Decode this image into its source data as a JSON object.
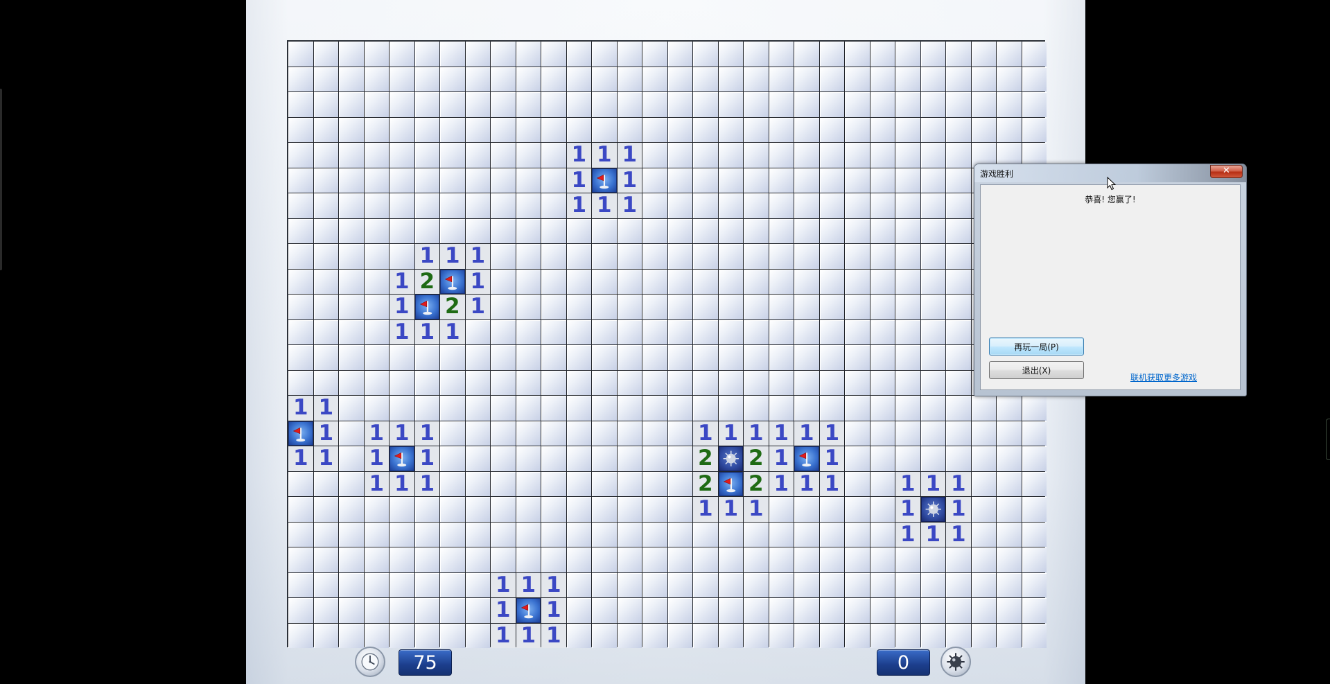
{
  "game": {
    "columns": 30,
    "rows": 24,
    "time": "75",
    "mines_remaining": "0",
    "revealed": [
      {
        "r": 4,
        "c": 11,
        "v": "1"
      },
      {
        "r": 4,
        "c": 12,
        "v": "1"
      },
      {
        "r": 4,
        "c": 13,
        "v": "1"
      },
      {
        "r": 5,
        "c": 11,
        "v": "1"
      },
      {
        "r": 5,
        "c": 12,
        "v": "flag"
      },
      {
        "r": 5,
        "c": 13,
        "v": "1"
      },
      {
        "r": 6,
        "c": 11,
        "v": "1"
      },
      {
        "r": 6,
        "c": 12,
        "v": "1"
      },
      {
        "r": 6,
        "c": 13,
        "v": "1"
      },
      {
        "r": 8,
        "c": 5,
        "v": "1"
      },
      {
        "r": 8,
        "c": 6,
        "v": "1"
      },
      {
        "r": 8,
        "c": 7,
        "v": "1"
      },
      {
        "r": 9,
        "c": 4,
        "v": "1"
      },
      {
        "r": 9,
        "c": 5,
        "v": "2"
      },
      {
        "r": 9,
        "c": 6,
        "v": "flag"
      },
      {
        "r": 9,
        "c": 7,
        "v": "1"
      },
      {
        "r": 10,
        "c": 4,
        "v": "1"
      },
      {
        "r": 10,
        "c": 5,
        "v": "flag"
      },
      {
        "r": 10,
        "c": 6,
        "v": "2"
      },
      {
        "r": 10,
        "c": 7,
        "v": "1"
      },
      {
        "r": 11,
        "c": 4,
        "v": "1"
      },
      {
        "r": 11,
        "c": 5,
        "v": "1"
      },
      {
        "r": 11,
        "c": 6,
        "v": "1"
      },
      {
        "r": 14,
        "c": 0,
        "v": "1"
      },
      {
        "r": 14,
        "c": 1,
        "v": "1"
      },
      {
        "r": 15,
        "c": 0,
        "v": "flag"
      },
      {
        "r": 15,
        "c": 1,
        "v": "1"
      },
      {
        "r": 16,
        "c": 0,
        "v": "1"
      },
      {
        "r": 16,
        "c": 1,
        "v": "1"
      },
      {
        "r": 15,
        "c": 3,
        "v": "1"
      },
      {
        "r": 15,
        "c": 4,
        "v": "1"
      },
      {
        "r": 15,
        "c": 5,
        "v": "1"
      },
      {
        "r": 16,
        "c": 3,
        "v": "1"
      },
      {
        "r": 16,
        "c": 4,
        "v": "flag"
      },
      {
        "r": 16,
        "c": 5,
        "v": "1"
      },
      {
        "r": 17,
        "c": 3,
        "v": "1"
      },
      {
        "r": 17,
        "c": 4,
        "v": "1"
      },
      {
        "r": 17,
        "c": 5,
        "v": "1"
      },
      {
        "r": 15,
        "c": 16,
        "v": "1"
      },
      {
        "r": 15,
        "c": 17,
        "v": "1"
      },
      {
        "r": 15,
        "c": 18,
        "v": "1"
      },
      {
        "r": 15,
        "c": 19,
        "v": "1"
      },
      {
        "r": 15,
        "c": 20,
        "v": "1"
      },
      {
        "r": 15,
        "c": 21,
        "v": "1"
      },
      {
        "r": 16,
        "c": 16,
        "v": "2"
      },
      {
        "r": 16,
        "c": 17,
        "v": "mine"
      },
      {
        "r": 16,
        "c": 18,
        "v": "2"
      },
      {
        "r": 16,
        "c": 19,
        "v": "1"
      },
      {
        "r": 16,
        "c": 20,
        "v": "flag"
      },
      {
        "r": 16,
        "c": 21,
        "v": "1"
      },
      {
        "r": 17,
        "c": 16,
        "v": "2"
      },
      {
        "r": 17,
        "c": 17,
        "v": "flag"
      },
      {
        "r": 17,
        "c": 18,
        "v": "2"
      },
      {
        "r": 17,
        "c": 19,
        "v": "1"
      },
      {
        "r": 17,
        "c": 20,
        "v": "1"
      },
      {
        "r": 17,
        "c": 21,
        "v": "1"
      },
      {
        "r": 18,
        "c": 16,
        "v": "1"
      },
      {
        "r": 18,
        "c": 17,
        "v": "1"
      },
      {
        "r": 18,
        "c": 18,
        "v": "1"
      },
      {
        "r": 17,
        "c": 24,
        "v": "1"
      },
      {
        "r": 17,
        "c": 25,
        "v": "1"
      },
      {
        "r": 17,
        "c": 26,
        "v": "1"
      },
      {
        "r": 18,
        "c": 24,
        "v": "1"
      },
      {
        "r": 18,
        "c": 25,
        "v": "mine"
      },
      {
        "r": 18,
        "c": 26,
        "v": "1"
      },
      {
        "r": 19,
        "c": 24,
        "v": "1"
      },
      {
        "r": 19,
        "c": 25,
        "v": "1"
      },
      {
        "r": 19,
        "c": 26,
        "v": "1"
      },
      {
        "r": 21,
        "c": 8,
        "v": "1"
      },
      {
        "r": 21,
        "c": 9,
        "v": "1"
      },
      {
        "r": 21,
        "c": 10,
        "v": "1"
      },
      {
        "r": 22,
        "c": 8,
        "v": "1"
      },
      {
        "r": 22,
        "c": 9,
        "v": "flag"
      },
      {
        "r": 22,
        "c": 10,
        "v": "1"
      },
      {
        "r": 23,
        "c": 8,
        "v": "1"
      },
      {
        "r": 23,
        "c": 9,
        "v": "1"
      },
      {
        "r": 23,
        "c": 10,
        "v": "1"
      }
    ]
  },
  "colors": {
    "number_1": "#3b48c4",
    "number_2": "#1f6b14",
    "counter_bg": "#1c3e8c"
  },
  "icons": {
    "timer": "clock-icon",
    "mines": "mine-icon",
    "flag": "flag-icon",
    "close": "close-icon"
  },
  "dialog": {
    "title": "游戏胜利",
    "close_label": "✕",
    "message": "恭喜! 您赢了!",
    "play_again": "再玩一局(P)",
    "exit": "退出(X)",
    "online_link": "联机获取更多游戏"
  }
}
